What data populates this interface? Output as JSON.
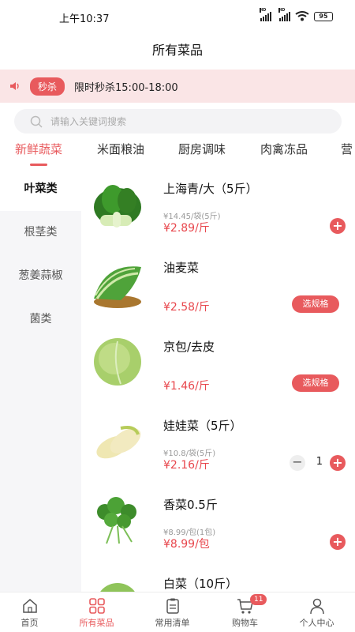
{
  "status": {
    "time": "上午10:37",
    "battery": "95",
    "hd": "HD"
  },
  "title": "所有菜品",
  "flash_sale": {
    "badge": "秒杀",
    "text": "限时秒杀15:00-18:00"
  },
  "search": {
    "placeholder": "请输入关键词搜索"
  },
  "category_tabs": [
    "新鲜蔬菜",
    "米面粮油",
    "厨房调味",
    "肉禽冻品",
    "营"
  ],
  "sidebar": [
    "叶菜类",
    "根茎类",
    "葱姜蒜椒",
    "菌类"
  ],
  "products": [
    {
      "name": "上海青/大（5斤）",
      "unit_price": "¥14.45/袋(5斤)",
      "price": "¥2.89/斤",
      "action": "add"
    },
    {
      "name": "油麦菜",
      "price": "¥2.58/斤",
      "action": "spec",
      "action_label": "选规格"
    },
    {
      "name": "京包/去皮",
      "price": "¥1.46/斤",
      "action": "spec",
      "action_label": "选规格"
    },
    {
      "name": "娃娃菜（5斤）",
      "unit_price": "¥10.8/袋(5斤)",
      "price": "¥2.16/斤",
      "action": "stepper",
      "qty": "1"
    },
    {
      "name": "香菜0.5斤",
      "unit_price": "¥8.99/包(1包)",
      "price": "¥8.99/包",
      "action": "add"
    },
    {
      "name": "白菜（10斤）"
    }
  ],
  "tabbar": [
    {
      "label": "首页",
      "icon": "home-icon"
    },
    {
      "label": "所有菜品",
      "icon": "grid-icon"
    },
    {
      "label": "常用清单",
      "icon": "list-icon"
    },
    {
      "label": "购物车",
      "icon": "cart-icon",
      "badge": "11"
    },
    {
      "label": "个人中心",
      "icon": "user-icon"
    }
  ],
  "colors": {
    "accent": "#e85a5d",
    "flash_bg": "#fae5e6",
    "sidebar_bg": "#f6f6f8"
  }
}
